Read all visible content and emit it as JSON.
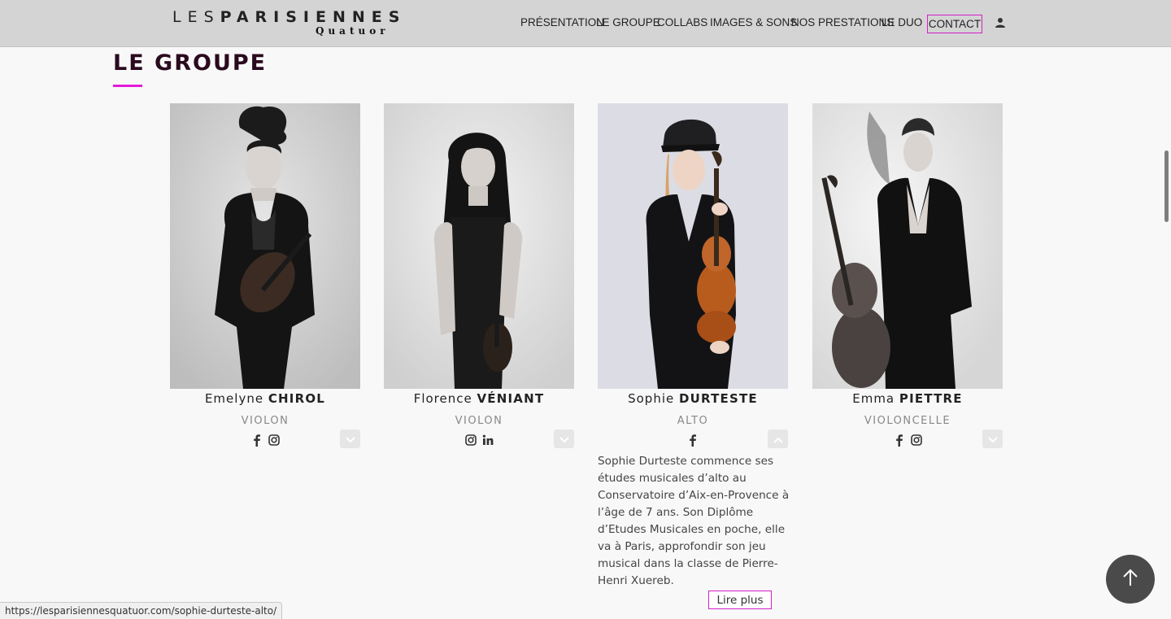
{
  "header": {
    "logo_part1": "LES",
    "logo_part2": "PARISIENNES",
    "logo_sub": "Quatuor",
    "nav": [
      {
        "label": "PRÉSENTATION"
      },
      {
        "label": "LE GROUPE"
      },
      {
        "label": "COLLABS"
      },
      {
        "label": "IMAGES & SONS"
      },
      {
        "label": "NOS PRESTATIONS"
      },
      {
        "label": "LE DUO"
      }
    ],
    "contact_label": "CONTACT",
    "user_icon": "user-icon"
  },
  "section": {
    "title": "LE GROUPE",
    "accent_color": "#e21ad8"
  },
  "members": [
    {
      "first_name": "Emelyne",
      "last_name": "CHIROL",
      "role": "VIOLON",
      "socials": [
        "facebook-icon",
        "instagram-icon"
      ],
      "toggle": "chevron-down-icon"
    },
    {
      "first_name": "Florence",
      "last_name": "VÉNIANT",
      "role": "VIOLON",
      "socials": [
        "instagram-icon",
        "linkedin-icon"
      ],
      "toggle": "chevron-down-icon"
    },
    {
      "first_name": "Sophie",
      "last_name": "DURTESTE",
      "role": "ALTO",
      "socials": [
        "facebook-icon"
      ],
      "toggle": "chevron-up-icon",
      "bio": "Sophie Durteste commence ses études musicales d’alto au Conservatoire d’Aix-en-Provence à l’âge de 7 ans. Son Diplôme d’Etudes Musicales en poche, elle va à Paris, approfondir son jeu musical dans la classe de Pierre-Henri Xuereb.",
      "read_more": "Lire plus"
    },
    {
      "first_name": "Emma",
      "last_name": "PIETTRE",
      "role": "VIOLONCELLE",
      "socials": [
        "facebook-icon",
        "instagram-icon"
      ],
      "toggle": "chevron-down-icon"
    }
  ],
  "status_url": "https://lesparisiennesquatuor.com/sophie-durteste-alto/",
  "scroll_top_icon": "arrow-up-icon"
}
